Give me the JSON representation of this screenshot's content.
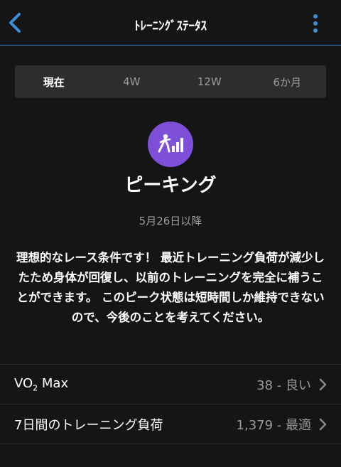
{
  "header": {
    "title": "ﾄﾚｰﾆﾝｸﾞｽﾃｰﾀｽ",
    "back_icon": "chevron-left-icon",
    "menu_icon": "kebab-icon"
  },
  "tabs": [
    {
      "label": "現在",
      "active": true
    },
    {
      "label": "4W",
      "active": false
    },
    {
      "label": "12W",
      "active": false
    },
    {
      "label": "6か月",
      "active": false
    }
  ],
  "status": {
    "icon": "peaking-icon",
    "icon_color": "#7e4fd8",
    "name": "ピーキング",
    "since": "5月26日以降",
    "description": "理想的なレース条件です！ 最近トレーニング負荷が減少したため身体が回復し、以前のトレーニングを完全に補うことができます。 このピーク状態は短時間しか維持できないので、今後のことを考えてください。"
  },
  "metrics": [
    {
      "label_main": "VO",
      "label_sub": "2",
      "label_tail": " Max",
      "value": "38 - 良い"
    },
    {
      "label": "7日間のトレーニング負荷",
      "value": "1,379 - 最適"
    }
  ],
  "colors": {
    "accent": "#3a8fd8",
    "background": "#151515"
  }
}
